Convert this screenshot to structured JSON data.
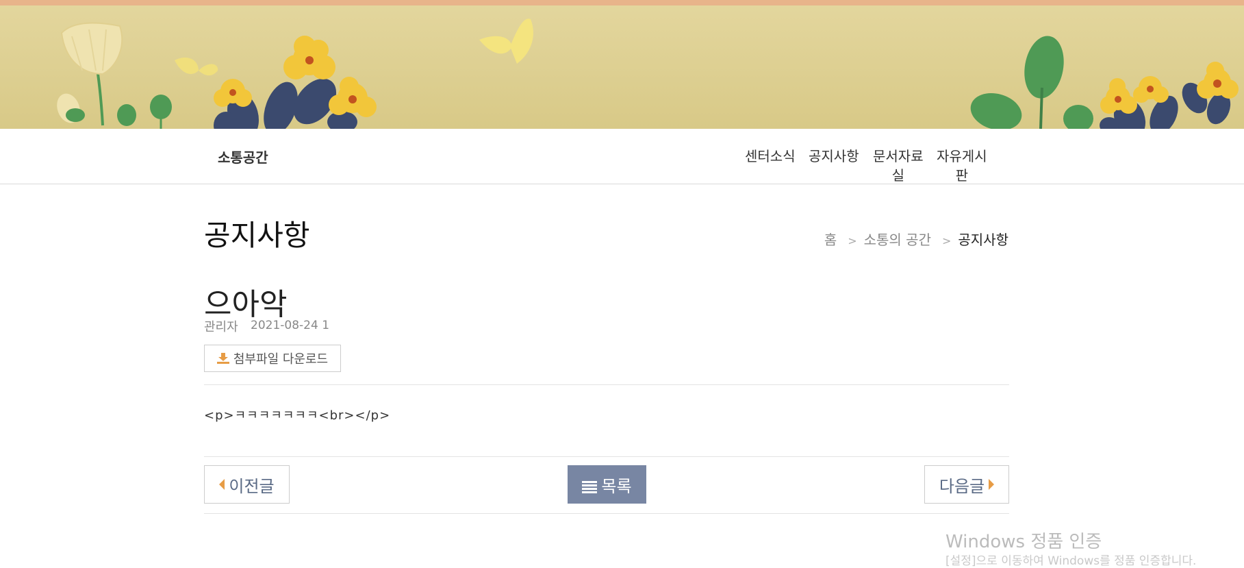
{
  "nav": {
    "brand": "소통공간",
    "items": [
      {
        "line1": "센터소식",
        "line2": ""
      },
      {
        "line1": "공지사항",
        "line2": ""
      },
      {
        "line1": "문서자료",
        "line2": "실"
      },
      {
        "line1": "자유게시",
        "line2": "판"
      }
    ]
  },
  "page": {
    "title": "공지사항"
  },
  "breadcrumb": {
    "home": "홈",
    "sep": ">",
    "section": "소통의 공간",
    "current": "공지사항"
  },
  "post": {
    "title": "으아악",
    "author": "관리자",
    "date": "2021-08-24 1",
    "download_label": "첨부파일 다운로드",
    "body": "<p>ㅋㅋㅋㅋㅋㅋㅋ<br></p>"
  },
  "pager": {
    "prev": "이전글",
    "list": "목록",
    "next": "다음글"
  },
  "watermark": {
    "title": "Windows 정품 인증",
    "subtitle": "[설정]으로 이동하여 Windows를 정품 인증합니다."
  },
  "colors": {
    "accent": "#e79c45",
    "list_button": "#7886a3",
    "banner": "#ddcf91"
  },
  "icons": {
    "download": "download-icon",
    "list": "list-icon",
    "prev": "triangle-left-icon",
    "next": "triangle-right-icon"
  }
}
